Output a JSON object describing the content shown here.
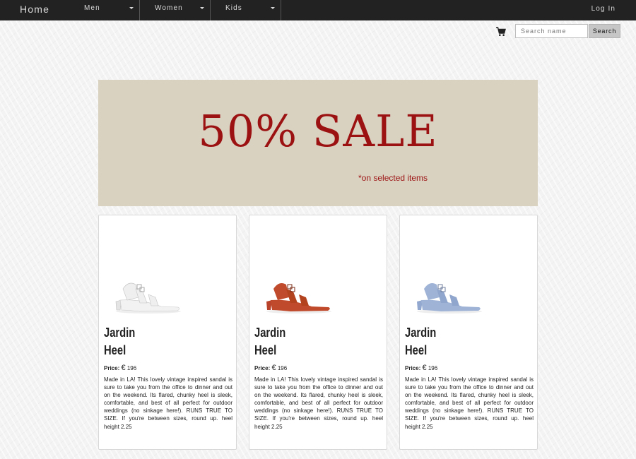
{
  "nav": {
    "home": "Home",
    "menus": [
      {
        "label": "Men"
      },
      {
        "label": "Women"
      },
      {
        "label": "Kids"
      }
    ],
    "login": "Log In"
  },
  "search": {
    "placeholder": "Search name",
    "button": "Search",
    "cart_icon": "cart-icon"
  },
  "banner": {
    "title": "50% SALE",
    "subtitle": "*on selected items",
    "bg_color": "#d9d2c1",
    "text_color": "#9c1212"
  },
  "products": [
    {
      "name_line1": "Jardin",
      "name_line2": "Heel",
      "price_label": "Price:",
      "currency": "€",
      "price": "196",
      "description": "Made in LA! This lovely vintage inspired sandal is sure to take you from the office to dinner and out on the weekend. Its flared, chunky heel is sleek, comfortable, and best of all perfect for outdoor weddings (no sinkage here!). RUNS TRUE TO SIZE. If you're between sizes, round up. heel height 2.25",
      "color": "#e8e8e8"
    },
    {
      "name_line1": "Jardin",
      "name_line2": "Heel",
      "price_label": "Price:",
      "currency": "€",
      "price": "196",
      "description": "Made in LA! This lovely vintage inspired sandal is sure to take you from the office to dinner and out on the weekend. Its flared, chunky heel is sleek, comfortable, and best of all perfect for outdoor weddings (no sinkage here!). RUNS TRUE TO SIZE. If you're between sizes, round up. heel height 2.25",
      "color": "#c04a2c"
    },
    {
      "name_line1": "Jardin",
      "name_line2": "Heel",
      "price_label": "Price:",
      "currency": "€",
      "price": "196",
      "description": "Made in LA! This lovely vintage inspired sandal is sure to take you from the office to dinner and out on the weekend. Its flared, chunky heel is sleek, comfortable, and best of all perfect for outdoor weddings (no sinkage here!). RUNS TRUE TO SIZE. If you're between sizes, round up. heel height 2.25",
      "color": "#9fb3d6"
    }
  ]
}
